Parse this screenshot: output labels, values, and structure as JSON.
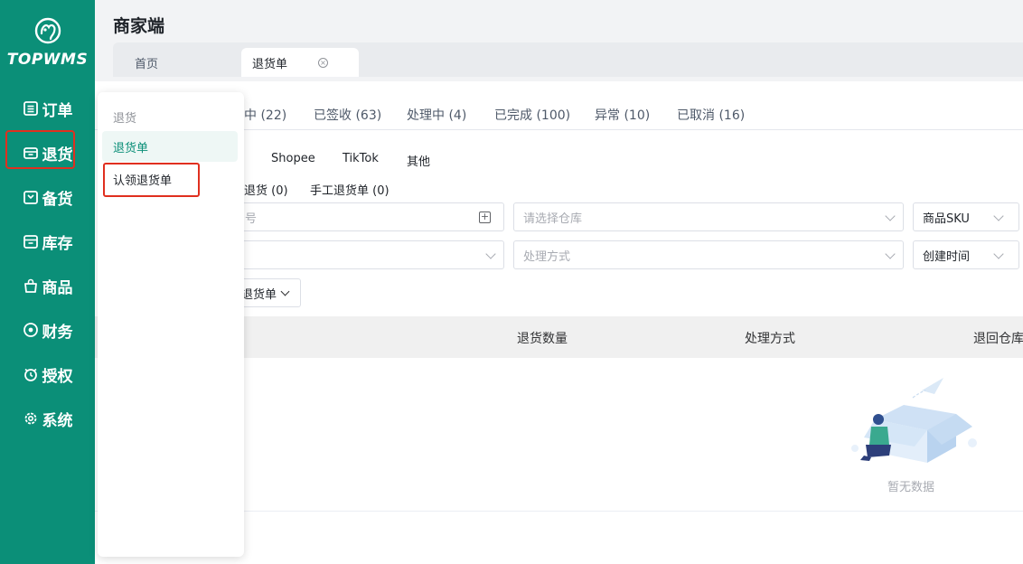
{
  "brand": {
    "name": "TOPWMS",
    "accent": "#0b8f78",
    "highlight": "#e02f1f"
  },
  "sidebar": {
    "items": [
      {
        "label": "订单",
        "icon": "list-icon"
      },
      {
        "label": "退货",
        "icon": "return-box-icon",
        "highlighted": true
      },
      {
        "label": "备货",
        "icon": "stock-box-icon"
      },
      {
        "label": "库存",
        "icon": "inventory-icon"
      },
      {
        "label": "商品",
        "icon": "bag-icon"
      },
      {
        "label": "财务",
        "icon": "finance-icon"
      },
      {
        "label": "授权",
        "icon": "clock-icon"
      },
      {
        "label": "系统",
        "icon": "gear-icon"
      }
    ]
  },
  "header": {
    "title": "商家端",
    "tabs": [
      {
        "label": "首页"
      },
      {
        "label": "退货单",
        "active": true
      }
    ]
  },
  "status_tabs": [
    "中 (22)",
    "已签收 (63)",
    "处理中 (4)",
    "已完成 (100)",
    "异常 (10)",
    "已取消 (16)"
  ],
  "platform_filters": [
    "Shopee",
    "TikTok",
    "其他"
  ],
  "type_filters": [
    "退货 (0)",
    "手工退货单 (0)"
  ],
  "filters": {
    "search_placeholder": "号",
    "warehouse_placeholder": "请选择仓库",
    "sku_select": "商品SKU",
    "processing_placeholder": "处理方式",
    "time_select": "创建时间",
    "type_dropdown": "退货单"
  },
  "table": {
    "columns": [
      "退货数量",
      "处理方式",
      "退回仓库"
    ],
    "empty_text": "暂无数据"
  },
  "popup_menu": {
    "group": "退货",
    "items": [
      {
        "label": "退货单",
        "active": true
      },
      {
        "label": "认领退货单",
        "highlighted": true
      }
    ]
  }
}
